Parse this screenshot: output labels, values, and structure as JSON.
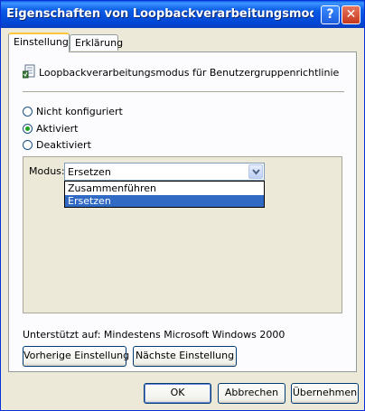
{
  "window": {
    "title": "Eigenschaften von Loopbackverarbeitungsmodus für ..."
  },
  "titlebar": {
    "help_glyph": "?",
    "close_glyph": "✕"
  },
  "tabs": [
    {
      "label": "Einstellung",
      "active": true
    },
    {
      "label": "Erklärung",
      "active": false
    }
  ],
  "policy": {
    "title": "Loopbackverarbeitungsmodus für Benutzergruppenrichtlinie",
    "icon": "policy-icon"
  },
  "radios": [
    {
      "label": "Nicht konfiguriert",
      "checked": false
    },
    {
      "label": "Aktiviert",
      "checked": true
    },
    {
      "label": "Deaktiviert",
      "checked": false
    }
  ],
  "options": {
    "modus_label": "Modus:",
    "selected_value": "Ersetzen",
    "dropdown_items": [
      {
        "label": "Zusammenführen",
        "highlighted": false
      },
      {
        "label": "Ersetzen",
        "highlighted": true
      }
    ]
  },
  "support": {
    "text": "Unterstützt auf:  Mindestens Microsoft Windows 2000"
  },
  "nav_buttons": {
    "previous": "Vorherige Einstellung",
    "next": "Nächste Einstellung"
  },
  "dialog_buttons": {
    "ok": "OK",
    "cancel": "Abbrechen",
    "apply": "Übernehmen"
  },
  "colors": {
    "titlebar": "#0147d6",
    "selection": "#316ac5",
    "face": "#ece9d8",
    "tab_accent": "#ffc73c"
  }
}
